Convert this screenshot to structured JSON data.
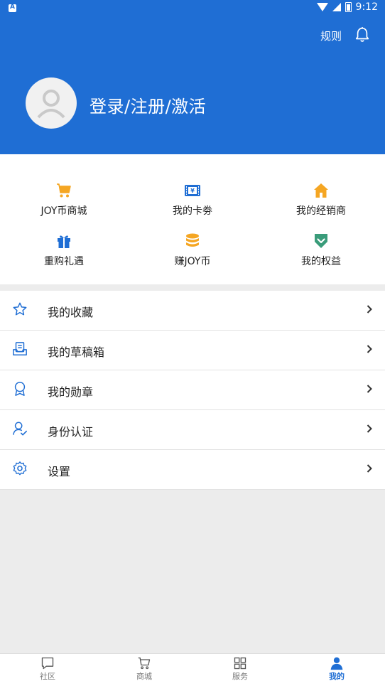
{
  "status_bar": {
    "time": "9:12"
  },
  "header": {
    "rules_label": "规则",
    "login_label": "登录/注册/激活"
  },
  "grid": [
    {
      "label": "JOY币商城",
      "icon": "cart-icon",
      "color": "#f5a623"
    },
    {
      "label": "我的卡劵",
      "icon": "ticket-icon",
      "color": "#1f6ed4"
    },
    {
      "label": "我的经销商",
      "icon": "house-icon",
      "color": "#f5a623"
    },
    {
      "label": "重购礼遇",
      "icon": "gift-icon",
      "color": "#1f6ed4"
    },
    {
      "label": "赚JOY币",
      "icon": "coins-icon",
      "color": "#f5a623"
    },
    {
      "label": "我的权益",
      "icon": "shield-check-icon",
      "color": "#3a9c7a"
    }
  ],
  "menu": [
    {
      "label": "我的收藏",
      "icon": "star-icon"
    },
    {
      "label": "我的草稿箱",
      "icon": "draft-icon"
    },
    {
      "label": "我的勋章",
      "icon": "medal-icon"
    },
    {
      "label": "身份认证",
      "icon": "user-verify-icon"
    },
    {
      "label": "设置",
      "icon": "gear-icon"
    }
  ],
  "tabs": [
    {
      "label": "社区",
      "icon": "chat-icon",
      "active": false
    },
    {
      "label": "商城",
      "icon": "cart-outline-icon",
      "active": false
    },
    {
      "label": "服务",
      "icon": "grid-icon",
      "active": false
    },
    {
      "label": "我的",
      "icon": "person-icon",
      "active": true
    }
  ],
  "colors": {
    "primary": "#1f6ed4",
    "accent": "#f5a623",
    "background": "#ececec"
  }
}
